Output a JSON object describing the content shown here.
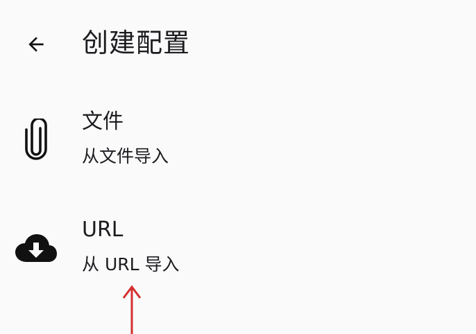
{
  "header": {
    "back_icon": "arrow-left-icon",
    "title": "创建配置"
  },
  "options": [
    {
      "icon": "paperclip-icon",
      "title": "文件",
      "subtitle": "从文件导入"
    },
    {
      "icon": "cloud-download-icon",
      "title": "URL",
      "subtitle": "从 URL 导入"
    }
  ],
  "colors": {
    "background": "#fafafa",
    "text": "#1c1b1f",
    "icon": "#111111",
    "annotation_arrow": "#d32f2f"
  }
}
